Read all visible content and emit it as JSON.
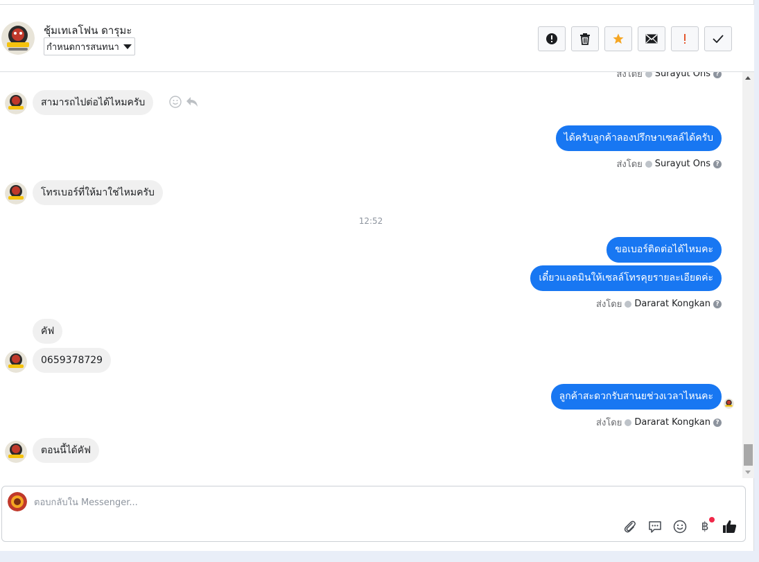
{
  "header": {
    "contact_name": "ชุ้มเทเลโฟน ดารุมะ",
    "label_dropdown": "กำหนดการสนทนา",
    "actions": [
      {
        "name": "report-spam-button",
        "icon": "alert-circle-icon"
      },
      {
        "name": "delete-button",
        "icon": "trash-icon"
      },
      {
        "name": "star-button",
        "icon": "star-icon"
      },
      {
        "name": "mark-unread-button",
        "icon": "envelope-icon"
      },
      {
        "name": "mark-important-button",
        "icon": "exclamation-icon"
      },
      {
        "name": "mark-done-button",
        "icon": "check-icon"
      }
    ]
  },
  "conversation": {
    "partial_sentby": {
      "prefix": "ส่งโดย",
      "name": "Surayut Ons"
    },
    "messages": [
      {
        "id": "m1",
        "dir": "in",
        "text": "สามารถไปต่อได้ไหมครับ"
      },
      {
        "id": "m2",
        "dir": "out",
        "text": "ได้ครับลูกค้าลองปรึกษาเซลล์ได้ครับ",
        "sent_by_prefix": "ส่งโดย",
        "sent_by": "Surayut Ons"
      },
      {
        "id": "m3",
        "dir": "in",
        "text": "โทรเบอร์ที่ให้มาใช่ไหมครับ"
      },
      {
        "id": "m4",
        "dir": "out",
        "text": "ขอเบอร์ติดต่อได้ไหมคะ"
      },
      {
        "id": "m5",
        "dir": "out",
        "text": "เดี๋ยวแอดมินให้เซลล์โทรคุยรายละเอียดค่ะ",
        "sent_by_prefix": "ส่งโดย",
        "sent_by": "Dararat Kongkan"
      },
      {
        "id": "m6",
        "dir": "in",
        "text": "คัฟ"
      },
      {
        "id": "m7",
        "dir": "in",
        "text": "0659378729"
      },
      {
        "id": "m8",
        "dir": "out",
        "text": "ลูกค้าสะดวกรับสานยช่วงเวลาไหนคะ",
        "sent_by_prefix": "ส่งโดย",
        "sent_by": "Dararat Kongkan"
      },
      {
        "id": "m9",
        "dir": "in",
        "text": "ตอนนี้ได้คัฟ"
      }
    ],
    "timestamp": "12:52"
  },
  "composer": {
    "placeholder": "ตอบกลับใน Messenger...",
    "tools": [
      "paperclip-icon",
      "saved-replies-icon",
      "emoji-icon",
      "baht-payment-icon",
      "thumbs-up-icon"
    ],
    "baht_symbol": "฿"
  },
  "colors": {
    "outgoing_bubble": "#1877f2",
    "incoming_bubble": "#f0f0f0",
    "star": "#f5a623",
    "important": "#e4572e",
    "notification_dot": "#f02849"
  }
}
